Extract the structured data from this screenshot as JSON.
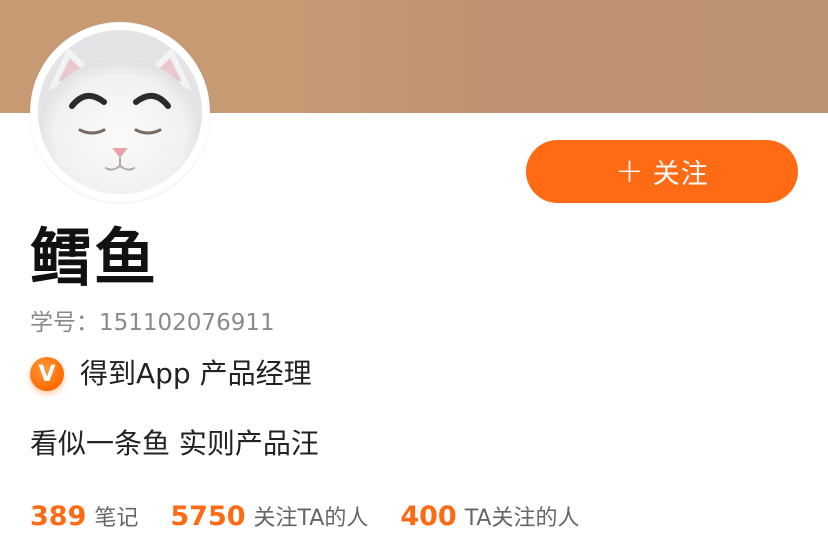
{
  "profile": {
    "name": "鳕鱼",
    "student_id": "学号：151102076911",
    "certification": "得到App 产品经理",
    "badge_letter": "V",
    "bio": "看似一条鱼 实则产品汪",
    "avatar_icon": "cat-avatar"
  },
  "follow_button": {
    "plus": "+",
    "label": "关注"
  },
  "stats": [
    {
      "value": "389",
      "label": "笔记"
    },
    {
      "value": "5750",
      "label": "关注TA的人"
    },
    {
      "value": "400",
      "label": "TA关注的人"
    }
  ],
  "colors": {
    "accent": "#ff6a14",
    "cover": "#c69a73",
    "text": "#222222",
    "muted": "#8a8a8a"
  }
}
